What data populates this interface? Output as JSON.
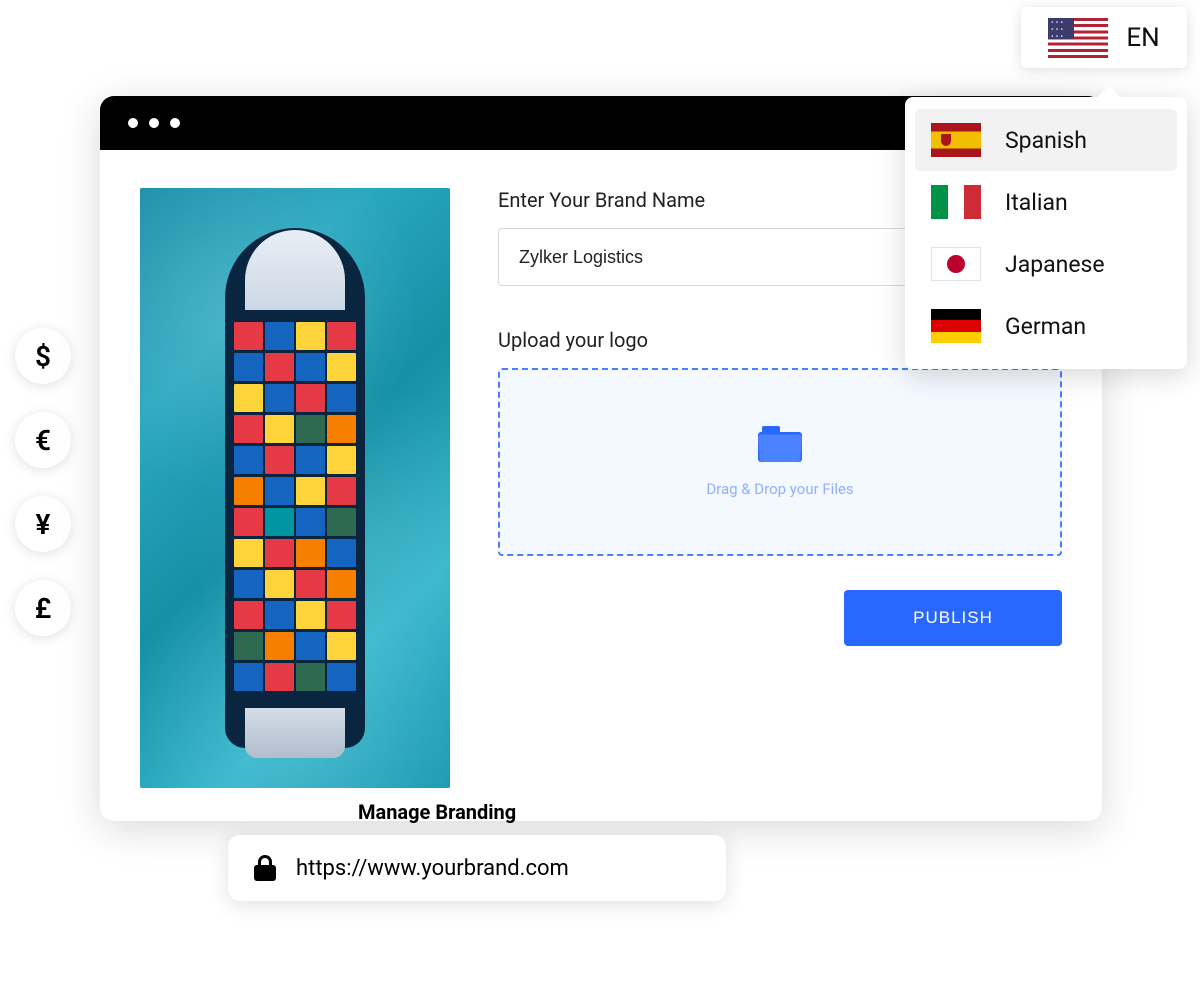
{
  "currencies": [
    {
      "symbol": "$",
      "name": "dollar"
    },
    {
      "symbol": "€",
      "name": "euro"
    },
    {
      "symbol": "¥",
      "name": "yen"
    },
    {
      "symbol": "£",
      "name": "pound"
    }
  ],
  "form": {
    "brand_name_label": "Enter Your Brand Name",
    "brand_name_value": "Zylker Logistics",
    "upload_label": "Upload your logo",
    "dropzone_text": "Drag & Drop your Files",
    "publish_label": "PUBLISH"
  },
  "branding": {
    "title": "Manage Branding",
    "url": "https://www.yourbrand.com"
  },
  "language": {
    "current_code": "EN",
    "options": [
      {
        "name": "Spanish",
        "flag": "spain"
      },
      {
        "name": "Italian",
        "flag": "italy"
      },
      {
        "name": "Japanese",
        "flag": "japan"
      },
      {
        "name": "German",
        "flag": "germany"
      }
    ]
  }
}
